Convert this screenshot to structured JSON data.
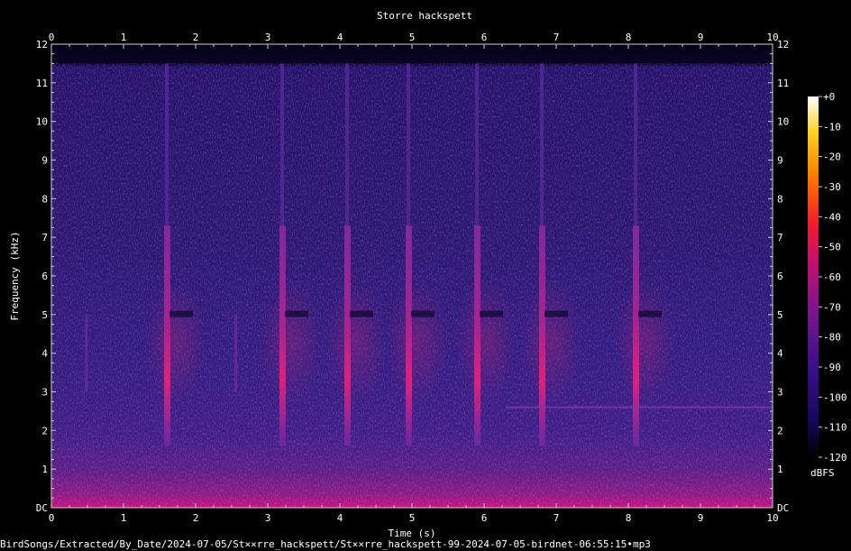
{
  "chart_data": {
    "type": "heatmap",
    "title": "Storre hackspett",
    "xlabel": "Time (s)",
    "ylabel": "Frequency (kHz)",
    "xlim": [
      0,
      10
    ],
    "ylim": [
      0,
      12
    ],
    "x_ticks": [
      "0",
      "1",
      "2",
      "3",
      "4",
      "5",
      "6",
      "7",
      "8",
      "9",
      "10"
    ],
    "y_ticks": [
      "DC",
      "1",
      "2",
      "3",
      "4",
      "5",
      "6",
      "7",
      "8",
      "9",
      "10",
      "11",
      "12"
    ],
    "colorbar": {
      "label": "dBFS",
      "ticks": [
        "+0",
        "-10",
        "-20",
        "-30",
        "-40",
        "-50",
        "-60",
        "-70",
        "-80",
        "-90",
        "-100",
        "-110",
        "-120"
      ],
      "range": [
        -120,
        0
      ]
    },
    "drum_strikes_s": [
      1.6,
      3.2,
      4.1,
      4.95,
      5.9,
      6.8,
      8.1
    ],
    "faint_strikes_s": [
      0.48,
      2.55
    ],
    "narrowband_tone": {
      "start_s": 6.3,
      "end_s": 10.0,
      "freq_khz": 2.6
    }
  },
  "footer": {
    "file_path": "BirdSongs/Extracted/By_Date/2024-07-05/St××rre_hackspett/St××rre_hackspett-99-2024-07-05-birdnet-06:55:15•mp3"
  }
}
